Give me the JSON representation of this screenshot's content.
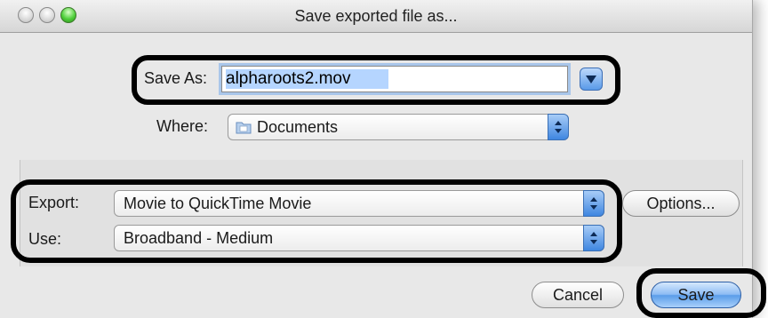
{
  "window": {
    "title": "Save exported file as..."
  },
  "save_as": {
    "label": "Save As:",
    "value": "alpharoots2.mov"
  },
  "where": {
    "label": "Where:",
    "value": "Documents",
    "icon": "folder-icon"
  },
  "export": {
    "label": "Export:",
    "value": "Movie to QuickTime Movie",
    "options_label": "Options..."
  },
  "use": {
    "label": "Use:",
    "value": "Broadband - Medium"
  },
  "buttons": {
    "cancel": "Cancel",
    "save": "Save"
  },
  "colors": {
    "accent": "#5a9de9",
    "selection": "#b5d5ff",
    "annotation": "#000000"
  }
}
